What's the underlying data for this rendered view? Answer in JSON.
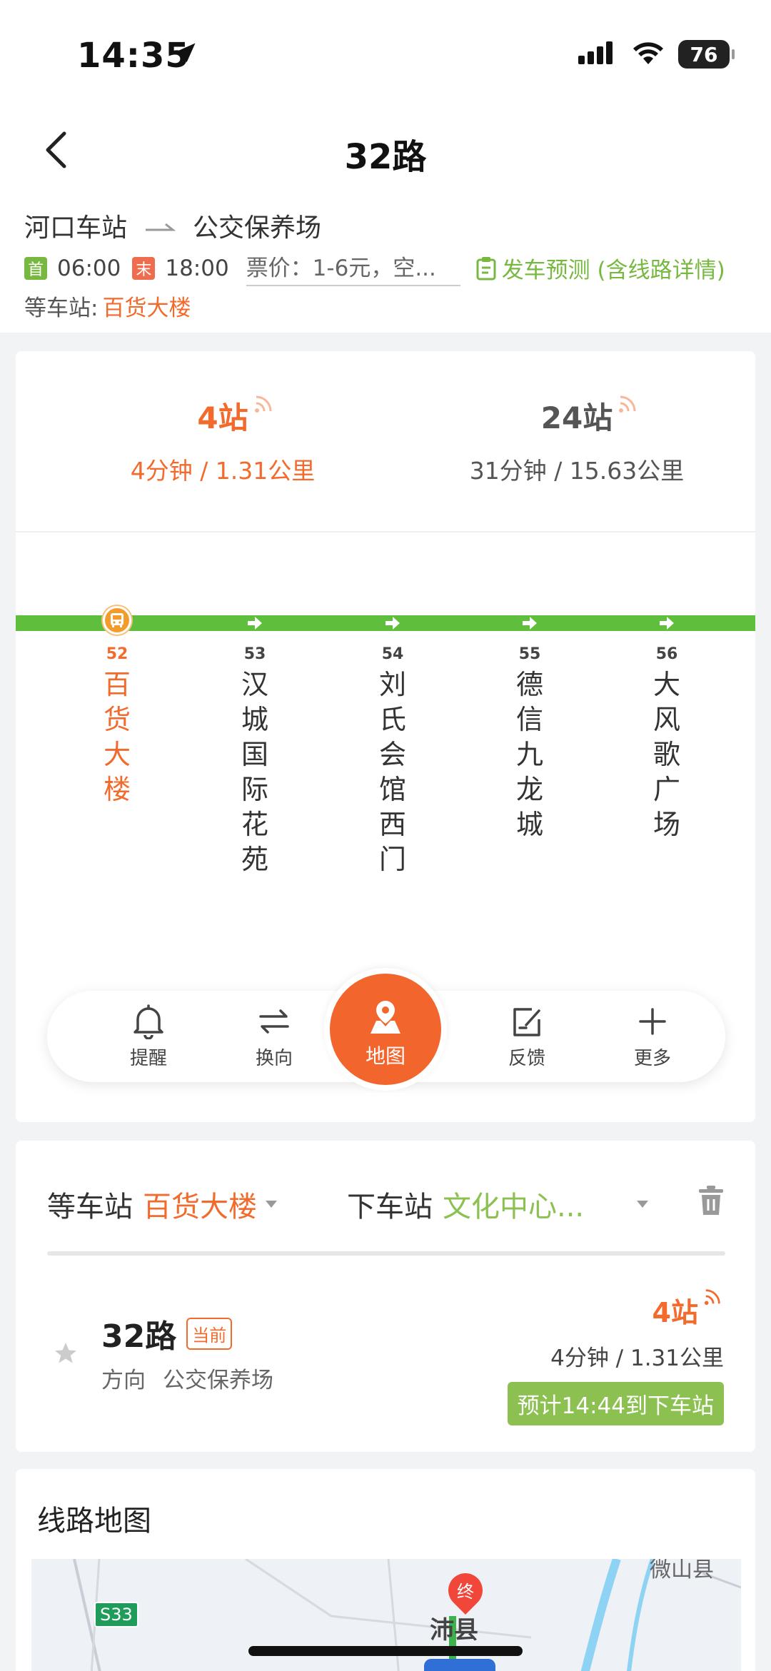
{
  "status_bar": {
    "time": "14:35",
    "battery": "76"
  },
  "header": {
    "title": "32路",
    "origin": "河口车站",
    "destination": "公交保养场",
    "first_tag": "首",
    "first_time": "06:00",
    "last_tag": "末",
    "last_time": "18:00",
    "fare": "票价：1-6元，空...",
    "forecast_label": "发车预测 (含线路详情)",
    "wait_label": "等车站:",
    "wait_station": "百货大楼"
  },
  "eta": {
    "first": {
      "stops": "4站",
      "detail": "4分钟 / 1.31公里"
    },
    "second": {
      "stops": "24站",
      "detail": "31分钟 / 15.63公里"
    }
  },
  "stations": [
    {
      "num": "52",
      "name": "百货大楼",
      "current": true
    },
    {
      "num": "53",
      "name": "汉城国际花苑",
      "current": false
    },
    {
      "num": "54",
      "name": "刘氏会馆西门",
      "current": false
    },
    {
      "num": "55",
      "name": "德信九龙城",
      "current": false
    },
    {
      "num": "56",
      "name": "大风歌广场",
      "current": false
    }
  ],
  "toolbar": {
    "remind": "提醒",
    "reverse": "换向",
    "map": "地图",
    "feedback": "反馈",
    "more": "更多"
  },
  "selector": {
    "wait_label": "等车站",
    "wait_value": "百货大楼",
    "alight_label": "下车站",
    "alight_value": "文化中心..."
  },
  "route_card": {
    "route": "32路",
    "current_tag": "当前",
    "direction_label": "方向",
    "direction_value": "公交保养场",
    "stops": "4站",
    "detail": "4分钟 / 1.31公里",
    "arrive": "预计14:44到下车站"
  },
  "map_section": {
    "title": "线路地图",
    "labels": {
      "road": "S33",
      "county": "沛县",
      "county2": "微山县",
      "end_tag": "终"
    }
  },
  "colors": {
    "accent": "#f26b2d",
    "green": "#5fbf3c",
    "light_green": "#8cc152"
  }
}
